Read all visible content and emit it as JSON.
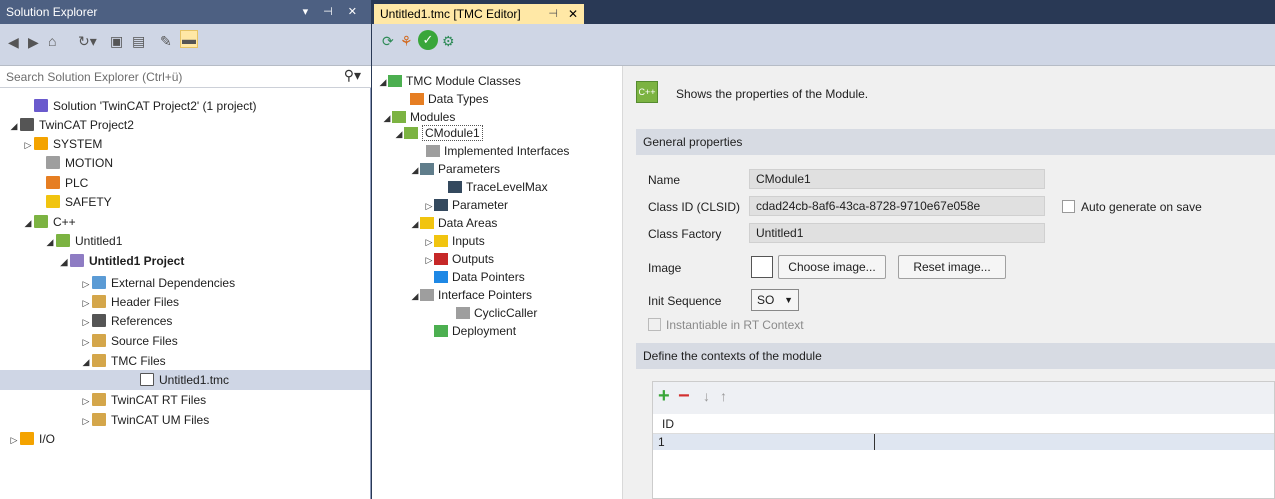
{
  "solution_explorer": {
    "title": "Solution Explorer",
    "pin_glyphs": "▾ ⊣ ✕",
    "search_placeholder": "Search Solution Explorer (Ctrl+ü)",
    "tree": [
      {
        "label": "Solution 'TwinCAT Project2' (1 project)",
        "icon": "solution-icon"
      },
      {
        "label": "TwinCAT Project2",
        "icon": "project-icon"
      },
      {
        "label": "SYSTEM",
        "icon": "system-icon"
      },
      {
        "label": "MOTION",
        "icon": "motion-icon"
      },
      {
        "label": "PLC",
        "icon": "plc-icon"
      },
      {
        "label": "SAFETY",
        "icon": "safety-icon"
      },
      {
        "label": "C++",
        "icon": "cpp-icon"
      },
      {
        "label": "Untitled1",
        "icon": "module-icon"
      },
      {
        "label": "Untitled1 Project",
        "icon": "cpp-project-icon"
      },
      {
        "label": "External Dependencies",
        "icon": "folder-icon"
      },
      {
        "label": "Header Files",
        "icon": "folder-icon"
      },
      {
        "label": "References",
        "icon": "references-icon"
      },
      {
        "label": "Source Files",
        "icon": "folder-icon"
      },
      {
        "label": "TMC Files",
        "icon": "folder-open-icon"
      },
      {
        "label": "Untitled1.tmc",
        "icon": "file-icon"
      },
      {
        "label": "TwinCAT RT Files",
        "icon": "folder-icon"
      },
      {
        "label": "TwinCAT UM Files",
        "icon": "folder-icon"
      },
      {
        "label": "I/O",
        "icon": "io-icon"
      }
    ]
  },
  "editor": {
    "tab_label": "Untitled1.tmc [TMC Editor]",
    "tree": [
      {
        "label": "TMC Module Classes"
      },
      {
        "label": "Data Types"
      },
      {
        "label": "Modules"
      },
      {
        "label": "CModule1"
      },
      {
        "label": "Implemented Interfaces"
      },
      {
        "label": "Parameters"
      },
      {
        "label": "TraceLevelMax"
      },
      {
        "label": "Parameter"
      },
      {
        "label": "Data Areas"
      },
      {
        "label": "Inputs"
      },
      {
        "label": "Outputs"
      },
      {
        "label": "Data Pointers"
      },
      {
        "label": "Interface Pointers"
      },
      {
        "label": "CyclicCaller"
      },
      {
        "label": "Deployment"
      }
    ],
    "props": {
      "header_text": "Shows the properties of the Module.",
      "general_section": "General properties",
      "name_label": "Name",
      "name_value": "CModule1",
      "clsid_label": "Class ID (CLSID)",
      "clsid_value": "cdad24cb-8af6-43ca-8728-9710e67e058e",
      "auto_generate_label": "Auto generate on save",
      "factory_label": "Class Factory",
      "factory_value": "Untitled1",
      "image_label": "Image",
      "choose_image": "Choose image...",
      "reset_image": "Reset image...",
      "init_label": "Init Sequence",
      "init_value": "SO",
      "instantiable_label": "Instantiable in RT Context",
      "contexts_section": "Define the contexts of the module",
      "grid_header": "ID",
      "grid_row_value": "1"
    }
  },
  "colors": {
    "chrome": "#293955",
    "title_bar": "#4d6082",
    "active_tab": "#ffe8a6",
    "toolbar": "#cfd6e5",
    "selection": "#cfd6e5"
  }
}
